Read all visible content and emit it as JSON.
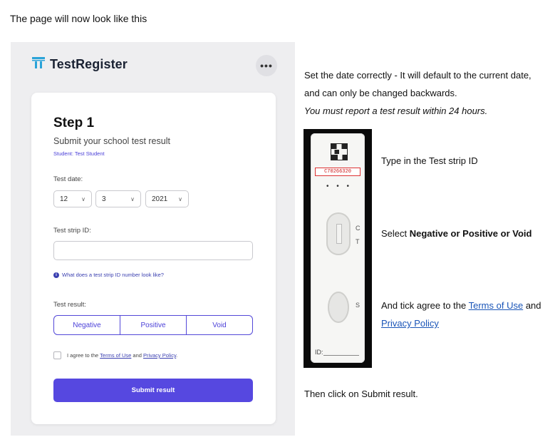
{
  "intro": "The page will now look like this",
  "app": {
    "brand": "TestRegister",
    "more_icon": "•••",
    "colors": {
      "accent": "#5648e0",
      "link": "#3a3fb0",
      "brand_icon": "#2aa3d8"
    }
  },
  "form": {
    "step_title": "Step 1",
    "subtitle": "Submit your school test result",
    "student": "Student: Test Student",
    "date_label": "Test date:",
    "day": "12",
    "month": "3",
    "year": "2021",
    "strip_label": "Test strip ID:",
    "strip_value": "",
    "help_link": "What does a test strip ID number look like?",
    "result_label": "Test result:",
    "results": [
      "Negative",
      "Positive",
      "Void"
    ],
    "agree_prefix": "I agree to the ",
    "terms": "Terms of Use",
    "agree_and": " and ",
    "privacy": "Privacy Policy",
    "agree_suffix": ".",
    "submit": "Submit result"
  },
  "instructions": {
    "date_bold": "Set the date correctly -",
    "date_text": " It will default to the current date, and can only be changed backwards.",
    "date_italic": "You must report a test result within 24 hours.",
    "strip_caption": "Type in the Test strip ID",
    "select_prefix": "Select ",
    "select_bold": "Negative or Positive or Void",
    "agree_prefix": "And tick agree to the ",
    "terms": "Terms of Use",
    "agree_and": " and ",
    "privacy": "Privacy Policy",
    "final": "Then click on Submit result."
  },
  "strip": {
    "id": "C70266320",
    "dots": "• • •",
    "c_label": "C",
    "t_label": "T",
    "s_label": "S",
    "id_label": "ID:"
  }
}
